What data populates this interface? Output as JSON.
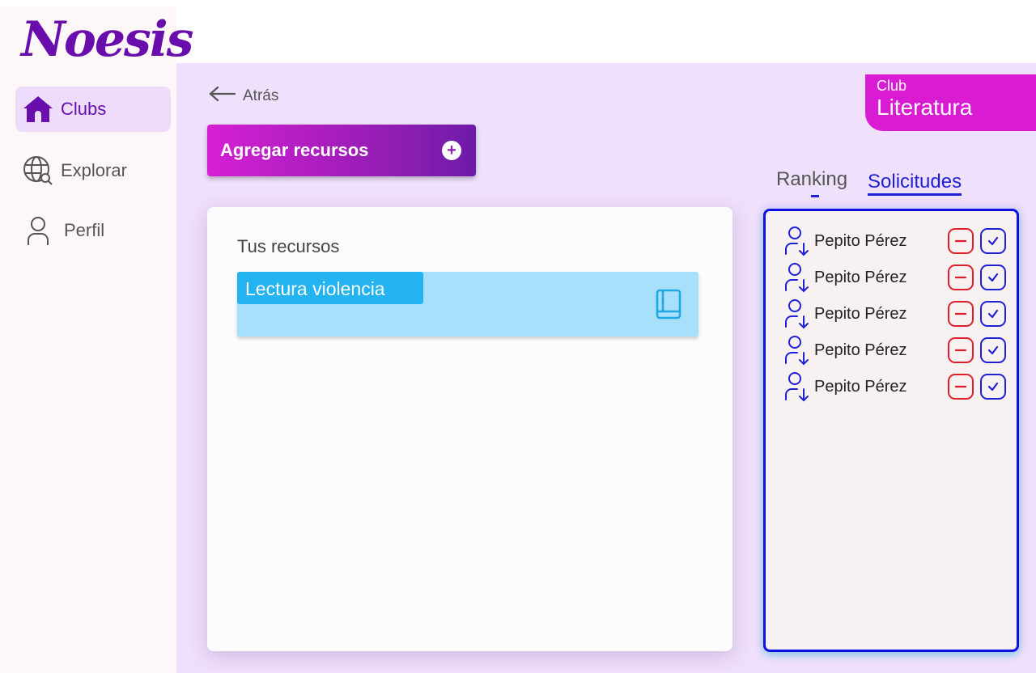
{
  "app": {
    "logo_text": "Noesis"
  },
  "sidebar": {
    "items": [
      {
        "label": "Clubs",
        "icon": "home-icon",
        "active": true
      },
      {
        "label": "Explorar",
        "icon": "globe-search-icon",
        "active": false
      },
      {
        "label": "Perfil",
        "icon": "user-icon",
        "active": false
      }
    ]
  },
  "header": {
    "back_label": "Atrás"
  },
  "actions": {
    "add_resources_label": "Agregar recursos"
  },
  "club": {
    "label": "Club",
    "name": "Literatura"
  },
  "resources": {
    "title": "Tus recursos",
    "items": [
      {
        "label": "Lectura violencia",
        "icon": "book-icon"
      }
    ]
  },
  "tabs": [
    {
      "label": "Ranking",
      "active": false
    },
    {
      "label": "Solicitudes",
      "active": true
    }
  ],
  "requests": [
    {
      "name": "Pepito Pérez"
    },
    {
      "name": "Pepito Pérez"
    },
    {
      "name": "Pepito Pérez"
    },
    {
      "name": "Pepito Pérez"
    },
    {
      "name": "Pepito Pérez"
    }
  ],
  "colors": {
    "brand": "#6a0dad",
    "accent": "#d91bd3",
    "accept": "#1f1fd6",
    "reject": "#e01d2b",
    "resource": "#22b3f0"
  }
}
